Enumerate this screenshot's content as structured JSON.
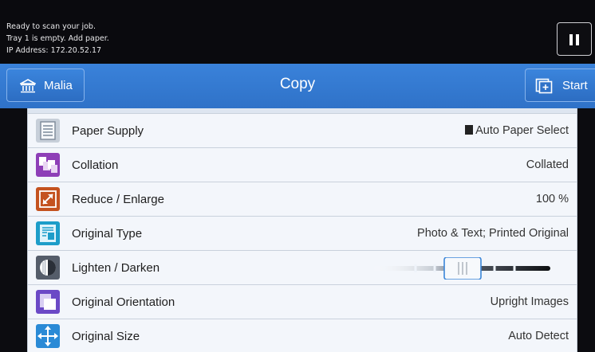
{
  "status": {
    "line1": "Ready to scan your job.",
    "line2": "Tray 1 is empty.  Add paper.",
    "line3": "IP Address: 172.20.52.17"
  },
  "header": {
    "home_label": "Malia",
    "title": "Copy",
    "start_label": "Start"
  },
  "features": [
    {
      "label": "Paper Supply",
      "value": "Auto Paper Select",
      "icon": "paper-supply-icon",
      "color": "#9aa7b6"
    },
    {
      "label": "Collation",
      "value": "Collated",
      "icon": "collation-icon",
      "color": "#8e3fb7"
    },
    {
      "label": "Reduce / Enlarge",
      "value": "100 %",
      "icon": "reduce-enlarge-icon",
      "color": "#c4521f"
    },
    {
      "label": "Original Type",
      "value": "Photo & Text; Printed Original",
      "icon": "original-type-icon",
      "color": "#1d9dc9"
    },
    {
      "label": "Lighten / Darken",
      "value": "",
      "icon": "lighten-darken-icon",
      "color": "#555d6a"
    },
    {
      "label": "Original Orientation",
      "value": "Upright Images",
      "icon": "original-orientation-icon",
      "color": "#6b49c6"
    },
    {
      "label": "Original Size",
      "value": "Auto Detect",
      "icon": "original-size-icon",
      "color": "#2a8ad6"
    }
  ],
  "lighten_darken_level": 0.5,
  "colors": {
    "titlebar": "#3079d2",
    "status_bg": "#0a0a0e"
  }
}
